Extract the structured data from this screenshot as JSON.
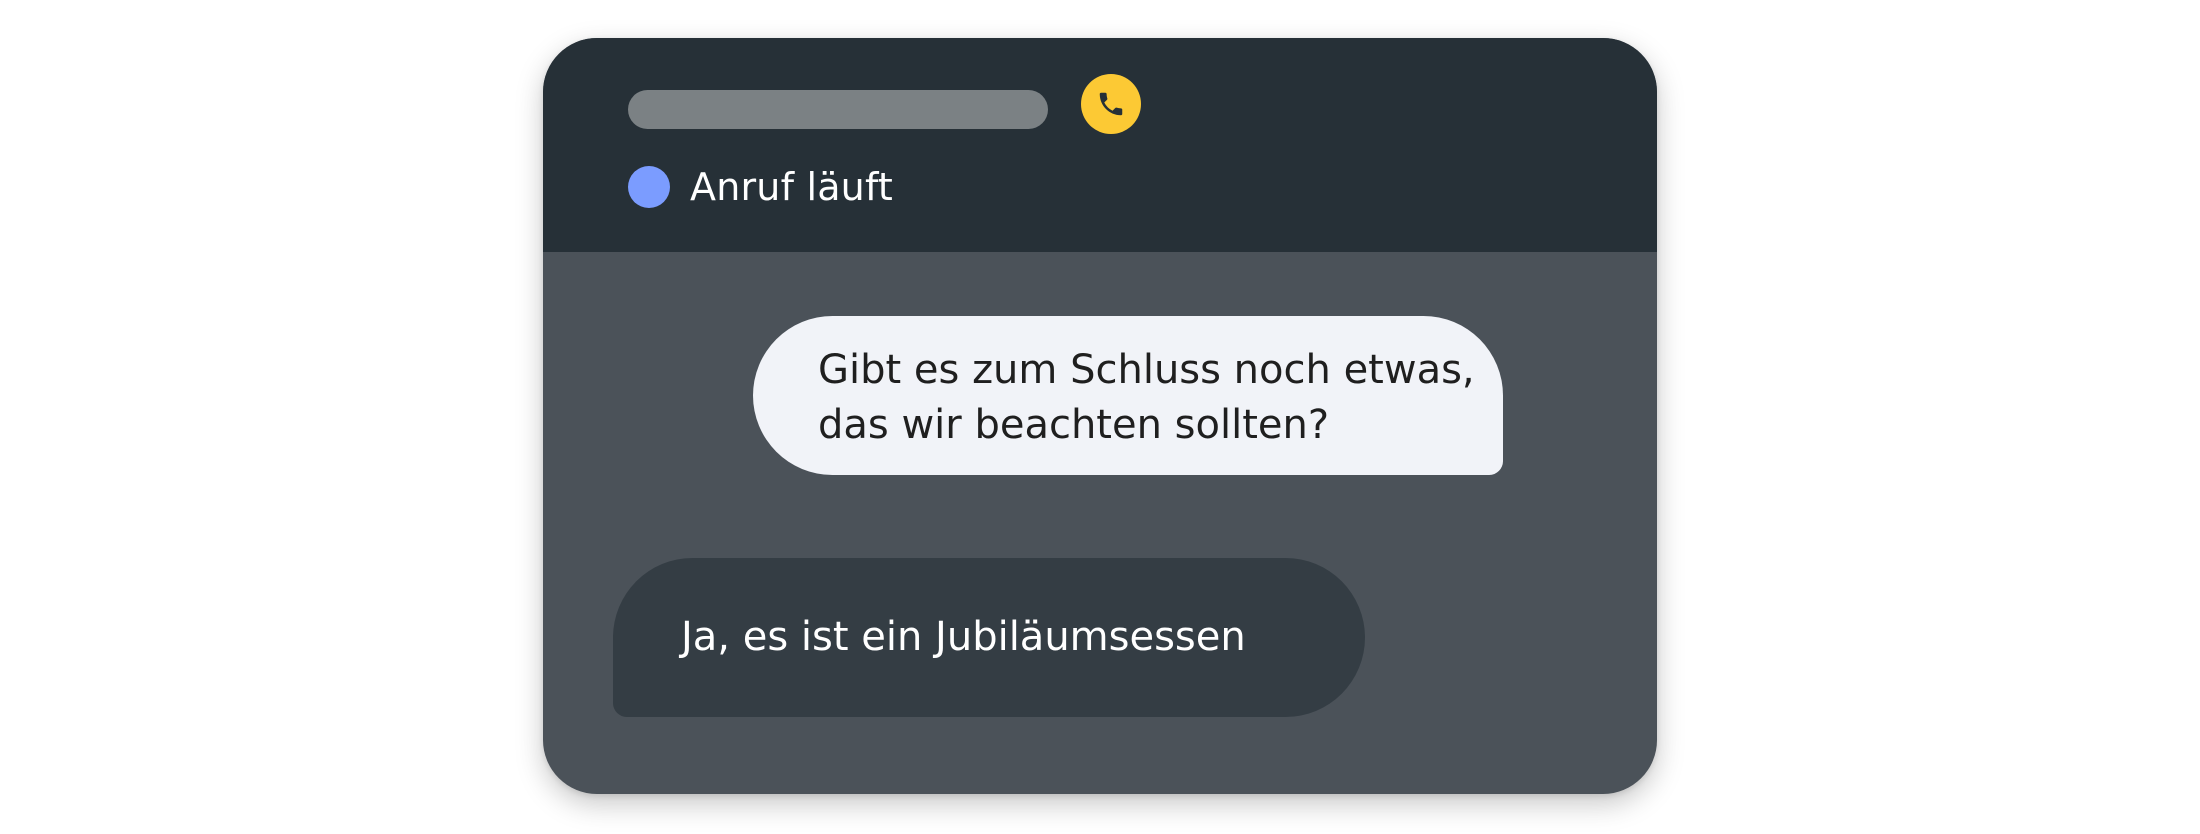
{
  "call": {
    "status_text": "Anruf läuft",
    "status_dot_color": "#7b9cff",
    "phone_icon": "phone-icon",
    "phone_badge_color": "#fcc934"
  },
  "messages": [
    {
      "direction": "outgoing",
      "lines": [
        "Gibt es zum Schluss noch etwas,",
        "das wir beachten sollten?"
      ]
    },
    {
      "direction": "incoming",
      "lines": [
        "Ja, es ist ein Jubiläumsessen"
      ]
    }
  ],
  "colors": {
    "header_background": "#263037",
    "body_background": "#4b5259",
    "outgoing_bubble": "#f1f3f8",
    "incoming_bubble": "#343d44"
  }
}
